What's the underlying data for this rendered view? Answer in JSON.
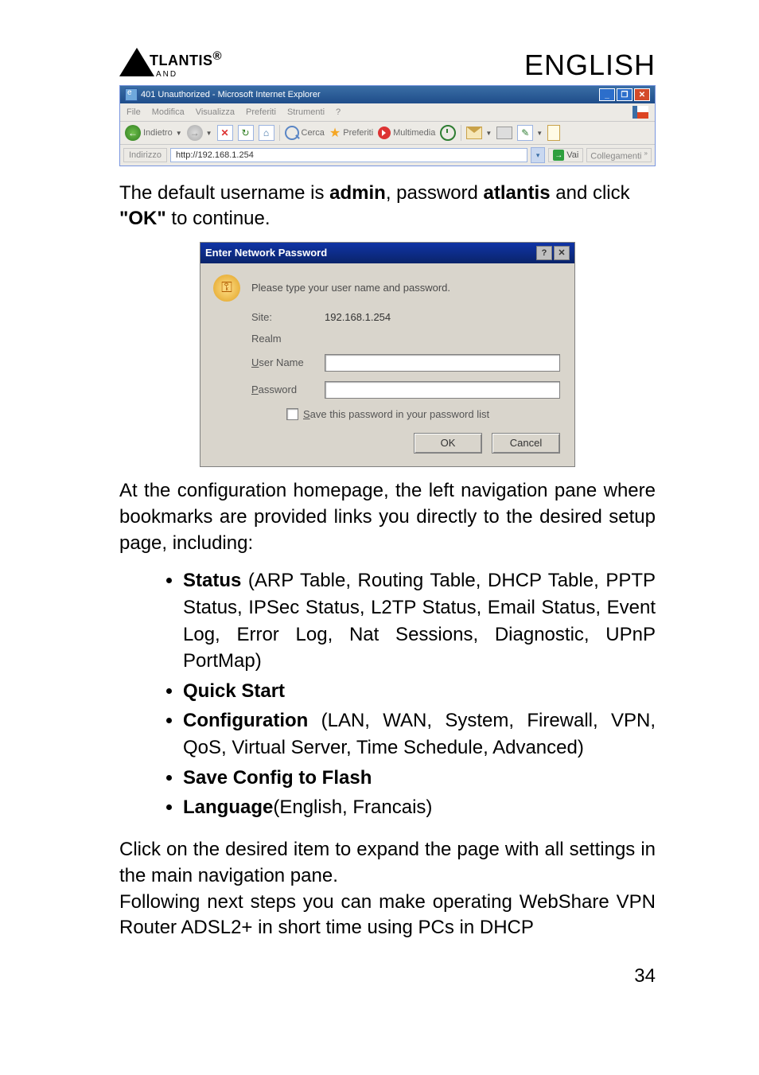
{
  "header": {
    "logo_main": "TLANTIS",
    "logo_reg": "®",
    "logo_sub": "AND",
    "lang": "ENGLISH"
  },
  "ie": {
    "title": "401 Unauthorized - Microsoft Internet Explorer",
    "menu": {
      "file": "File",
      "modifica": "Modifica",
      "visualizza": "Visualizza",
      "preferiti": "Preferiti",
      "strumenti": "Strumenti",
      "help": "?"
    },
    "toolbar": {
      "back": "Indietro",
      "cerca": "Cerca",
      "preferiti": "Preferiti",
      "multimedia": "Multimedia"
    },
    "addr_label": "Indirizzo",
    "addr_value": "http://192.168.1.254",
    "go": "Vai",
    "coll": "Collegamenti",
    "coll_sup": "»"
  },
  "intro": {
    "pre": "The default username is ",
    "user": "admin",
    "mid": ", password ",
    "pass": "atlantis",
    "post": " and click ",
    "ok": "\"OK\"",
    "tail": " to continue."
  },
  "dialog": {
    "title": "Enter Network Password",
    "prompt": "Please type your user name and password.",
    "site_label": "Site:",
    "site_value": "192.168.1.254",
    "realm_label": "Realm",
    "user_label_pre": "U",
    "user_label_post": "ser Name",
    "pass_label_pre": "P",
    "pass_label_post": "assword",
    "save_pre": "S",
    "save_post": "ave this password in your password list",
    "ok": "OK",
    "cancel": "Cancel"
  },
  "para1": "At the configuration homepage, the left navigation pane where bookmarks are provided links you directly to the desired setup page, including:",
  "bullets": {
    "status_bold": "Status",
    "status_rest": " (ARP Table, Routing Table, DHCP Table, PPTP Status, IPSec Status, L2TP Status, Email Status, Event Log, Error Log,  Nat Sessions, Diagnostic, UPnP PortMap)",
    "quick": "Quick Start",
    "config_bold": "Configuration",
    "config_rest": " (LAN, WAN, System, Firewall, VPN, QoS,  Virtual Server, Time Schedule, Advanced)",
    "save": "Save Config to Flash",
    "lang_bold": "Language",
    "lang_rest": "(English, Francais)"
  },
  "para2": "Click on the desired item to expand the page with all settings in the main navigation pane.",
  "para3": "Following next steps you can make operating WebShare VPN Router ADSL2+ in short time using PCs  in DHCP",
  "page_number": "34"
}
